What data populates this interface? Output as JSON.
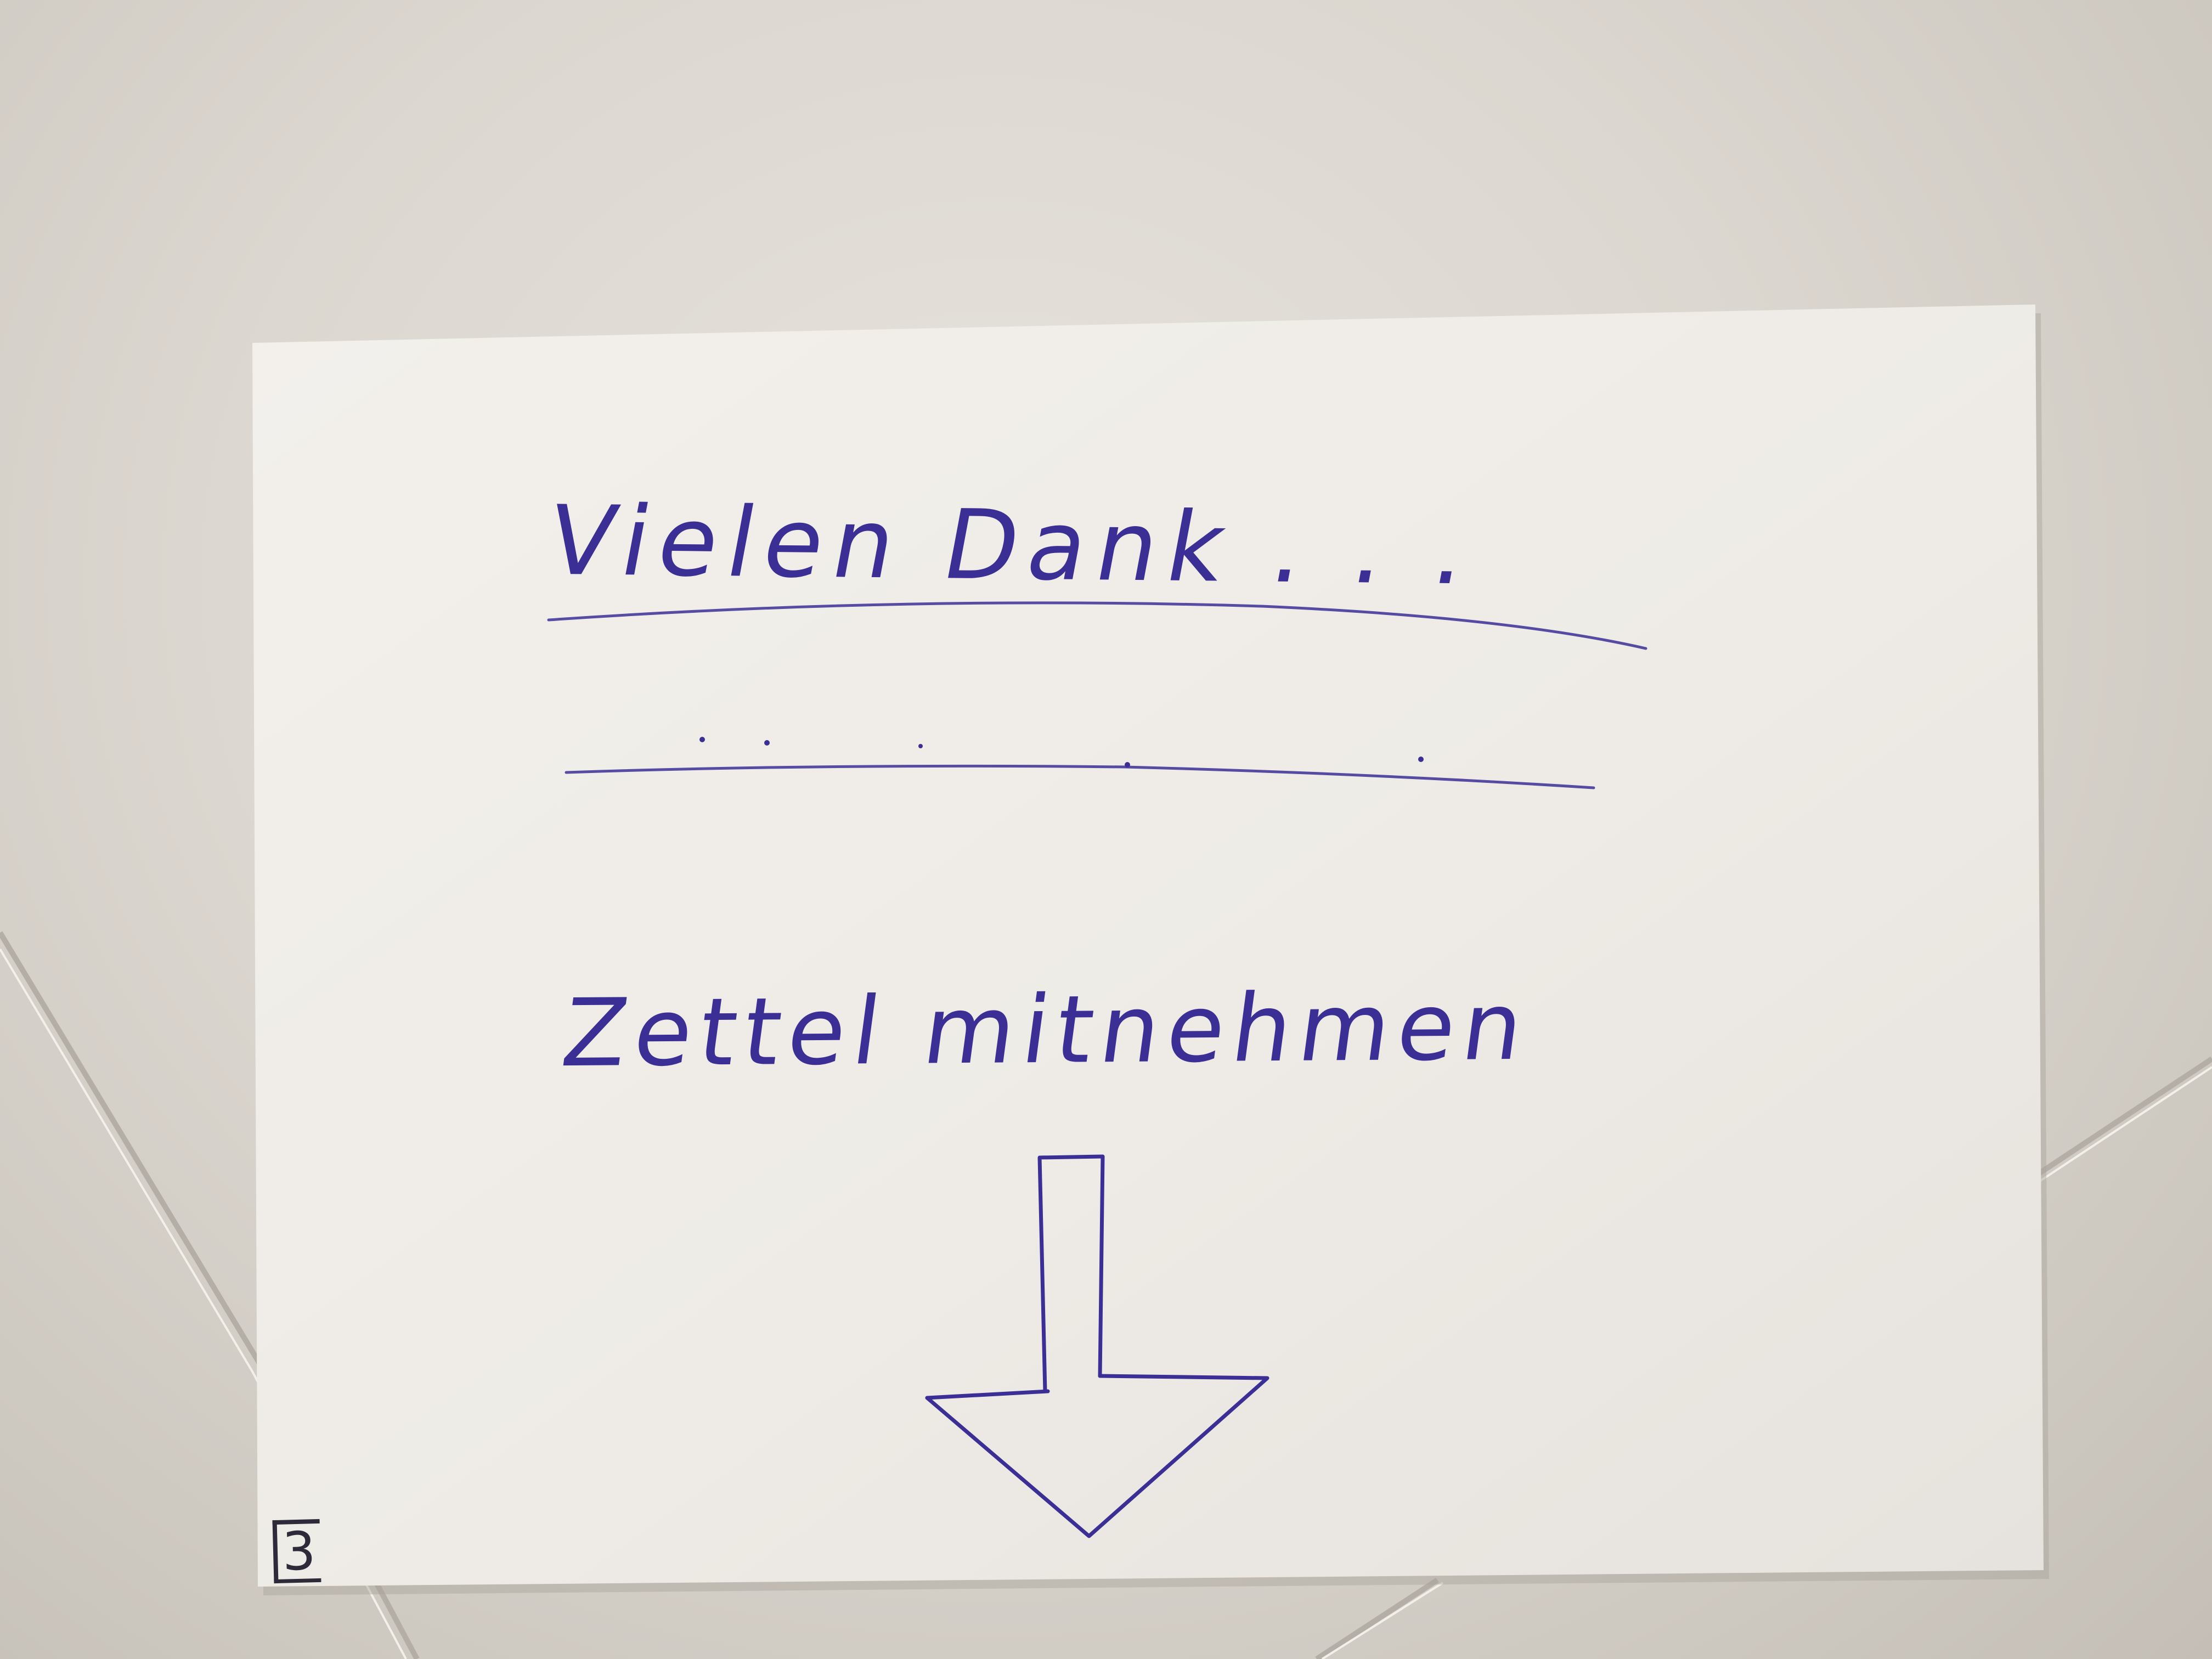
{
  "note": {
    "heading": "Vielen Dank . . .",
    "blank_line": ". . . . . .",
    "instruction": "Zettel mitnehmen",
    "page_number": "3",
    "arrow_icon": "down-arrow-icon"
  },
  "colors": {
    "ink": "#3b2f96",
    "paper": "#f1eeea",
    "tabletop": "#dcd7d0"
  }
}
